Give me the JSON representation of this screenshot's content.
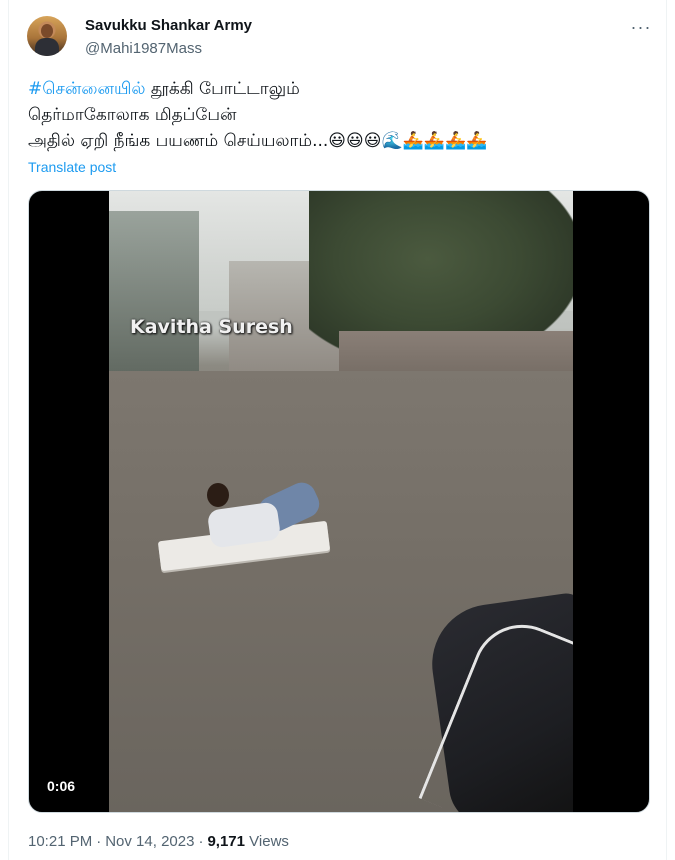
{
  "author": {
    "display_name": "Savukku Shankar Army",
    "handle": "@Mahi1987Mass"
  },
  "tweet": {
    "hashtag": "#சென்னையில்",
    "line1_rest": " தூக்கி போட்டாலும்",
    "line2": "தெர்மாகோலாக மிதப்பேன்",
    "line3": "அதில் ஏறி நீங்க பயணம் செய்யலாம்...",
    "emojis": "😃😃😃🌊🚣🚣🚣🚣",
    "translate_label": "Translate post"
  },
  "media": {
    "watermark": "Kavitha Suresh",
    "duration": "0:06"
  },
  "meta": {
    "time": "10:21 PM",
    "date": "Nov 14, 2023",
    "separator": "·",
    "views_count": "9,171",
    "views_label": "Views"
  },
  "icons": {
    "more": "more-horizontal-icon"
  }
}
